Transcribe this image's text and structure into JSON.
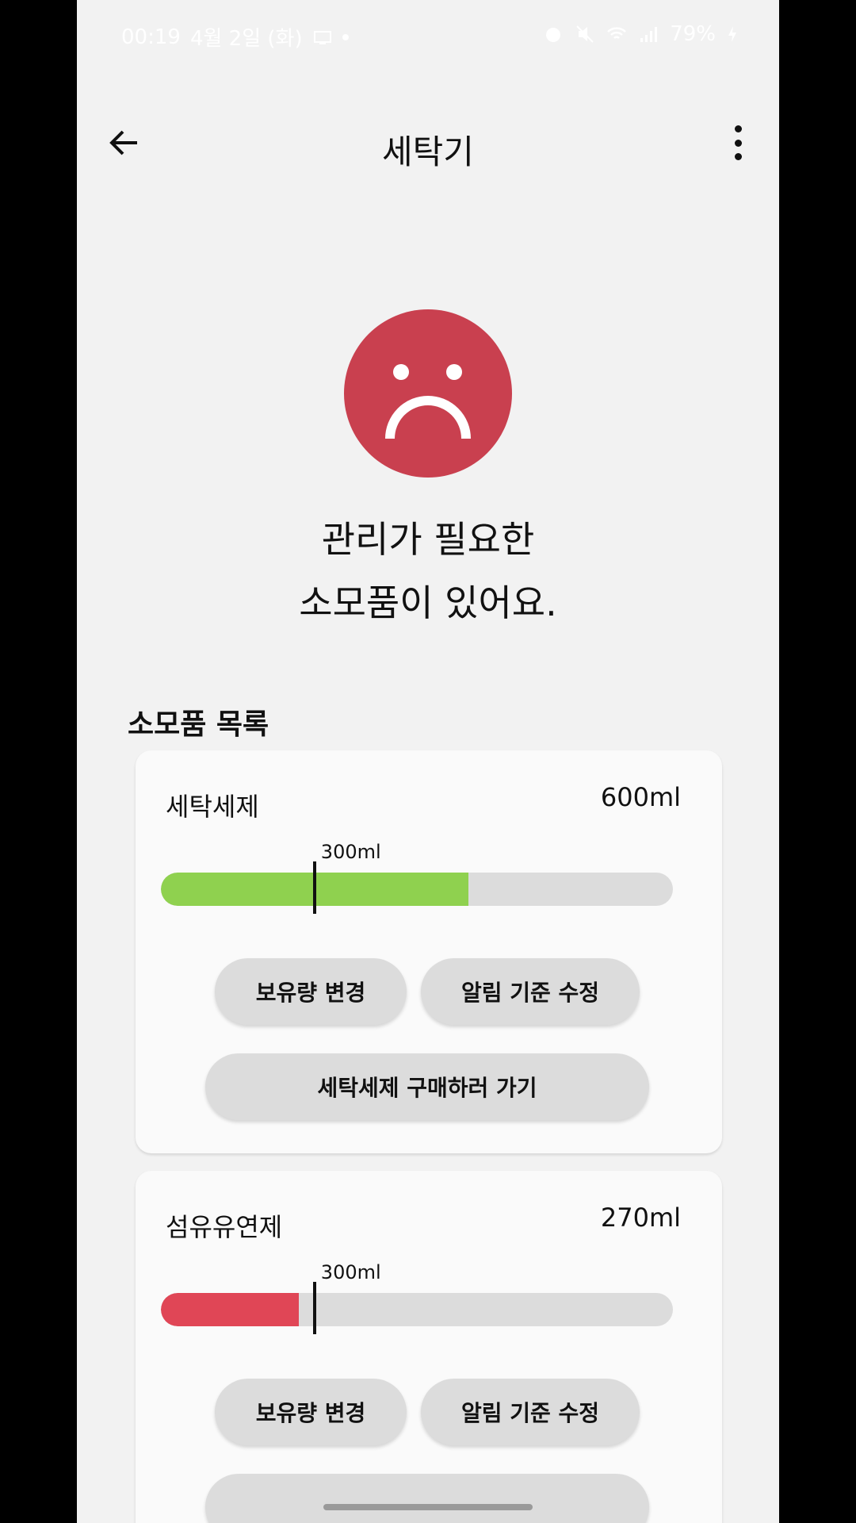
{
  "status_bar": {
    "time": "00:19",
    "date": "4월 2일 (화)",
    "battery": "79%"
  },
  "app_bar": {
    "title": "세탁기",
    "back_icon": "arrow-left-icon",
    "more_icon": "more-vertical-icon"
  },
  "status": {
    "face_icon": "sad-face-icon",
    "face_color": "#c9404f",
    "headline_line1": "관리가 필요한",
    "headline_line2": "소모품이 있어요."
  },
  "section_title": "소모품 목록",
  "consumables": [
    {
      "name": "세탁세제",
      "amount": "600ml",
      "threshold_label": "300ml",
      "level_fraction": 0.6,
      "threshold_fraction": 0.3,
      "fill_color": "#8fd14f",
      "buttons": {
        "change": "보유량 변경",
        "alert": "알림 기준 수정",
        "buy": "세탁세제 구매하러 가기"
      }
    },
    {
      "name": "섬유유연제",
      "amount": "270ml",
      "threshold_label": "300ml",
      "level_fraction": 0.27,
      "threshold_fraction": 0.3,
      "fill_color": "#e04656",
      "buttons": {
        "change": "보유량 변경",
        "alert": "알림 기준 수정"
      }
    }
  ]
}
